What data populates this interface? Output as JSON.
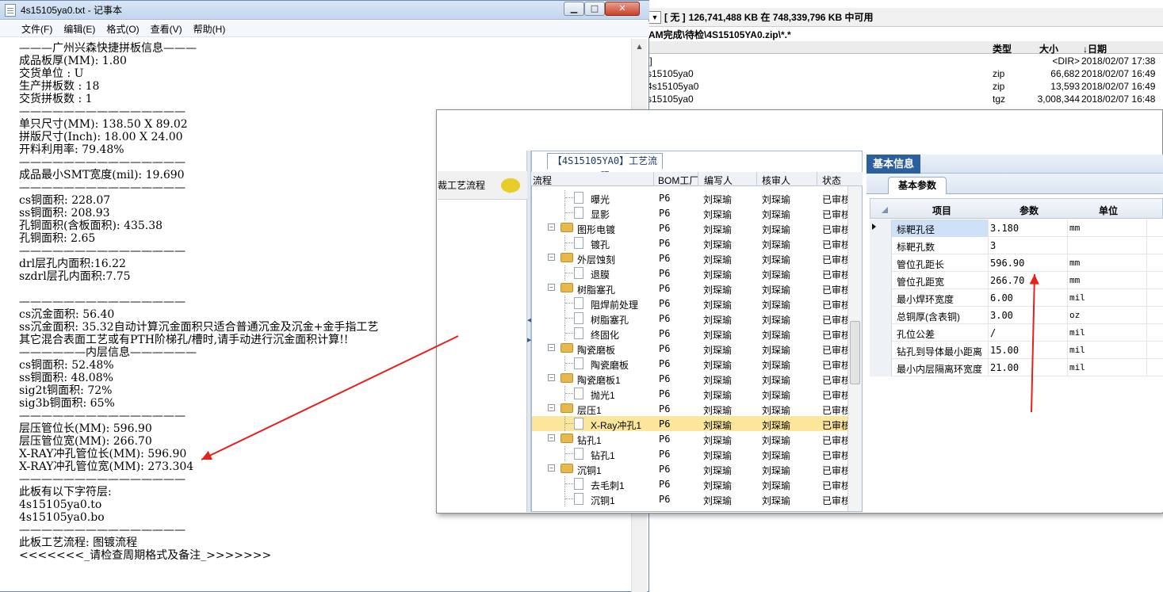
{
  "file_manager": {
    "left_fragment": "b 在",
    "drive_label": "[ 无 ]",
    "free_space": "126,741,488 KB 在 748,339,796 KB 中可用",
    "path": "AM完成\\待检\\4S15105YA0.zip\\*.*",
    "headers": {
      "type": "类型",
      "size": "大小",
      "date": "↓日期"
    },
    "rows": [
      {
        "name": ".]",
        "type": "",
        "size": "<DIR>",
        "date": "2018/02/07 17:38"
      },
      {
        "name": "s15105ya0",
        "type": "zip",
        "size": "66,682",
        "date": "2018/02/07 16:49"
      },
      {
        "name": "4s15105ya0",
        "type": "zip",
        "size": "13,593",
        "date": "2018/02/07 16:49"
      },
      {
        "name": "s15105ya0",
        "type": "tgz",
        "size": "3,008,344",
        "date": "2018/02/07 16:48"
      }
    ]
  },
  "notepad": {
    "title": "4s15105ya0.txt - 记事本",
    "window_buttons": {
      "minimize": "▁",
      "maximize": "□",
      "close": "✕"
    },
    "menu": [
      "文件(F)",
      "编辑(E)",
      "格式(O)",
      "查看(V)",
      "帮助(H)"
    ],
    "lines": [
      "———广州兴森快捷拼板信息———",
      "成品板厚(MM): 1.80",
      "交货单位 : U",
      "生产拼板数 : 18",
      "交货拼板数 : 1",
      "———————————————",
      "单只尺寸(MM): 138.50 X 89.02",
      "拼版尺寸(Inch): 18.00 X 24.00",
      "开料利用率: 79.48%",
      "———————————————",
      "成品最小SMT宽度(mil): 19.690",
      "———————————————",
      "cs铜面积: 228.07",
      "ss铜面积: 208.93",
      "孔铜面积(含板面积): 435.38",
      "孔铜面积: 2.65",
      "———————————————",
      "drl层孔内面积:16.22",
      "szdrl层孔内面积:7.75",
      "",
      "———————————————",
      "cs沉金面积: 56.40",
      "ss沉金面积: 35.32自动计算沉金面积只适合普通沉金及沉金+金手指工艺",
      "其它混合表面工艺或有PTH阶梯孔/槽时,请手动进行沉金面积计算!!",
      "——————内层信息——————",
      "cs铜面积: 52.48%",
      "ss铜面积: 48.08%",
      "sig2t铜面积: 72%",
      "sig3b铜面积: 65%",
      "———————————————",
      "层压管位长(MM): 596.90",
      "层压管位宽(MM): 266.70",
      "X-RAY冲孔管位长(MM): 596.90",
      "X-RAY冲孔管位宽(MM): 273.304",
      "———————————————",
      "此板有以下字符层:",
      "4s15105ya0.to",
      "4s15105ya0.bo",
      "———————————————",
      "此板工艺流程: 图镀流程",
      "<<<<<<<_请检查周期格式及备注_>>>>>>>"
    ]
  },
  "process_dialog": {
    "left_panel_label": "裁工艺流程",
    "flow_tab": "【4S15105YA0】工艺流程",
    "columns": [
      "流程",
      "BOM工厂",
      "编写人",
      "核审人",
      "状态"
    ],
    "rows": [
      {
        "name": "曝光",
        "level": 2,
        "kind": "doc",
        "bom": "P6",
        "writer": "刘琛瑜",
        "reviewer": "刘琛瑜",
        "status": "已审核"
      },
      {
        "name": "显影",
        "level": 2,
        "kind": "doc",
        "bom": "P6",
        "writer": "刘琛瑜",
        "reviewer": "刘琛瑜",
        "status": "已审核"
      },
      {
        "name": "图形电镀",
        "level": 1,
        "kind": "folder",
        "bom": "P6",
        "writer": "刘琛瑜",
        "reviewer": "刘琛瑜",
        "status": "已审核"
      },
      {
        "name": "镀孔",
        "level": 2,
        "kind": "doc",
        "bom": "P6",
        "writer": "刘琛瑜",
        "reviewer": "刘琛瑜",
        "status": "已审核"
      },
      {
        "name": "外层蚀刻",
        "level": 1,
        "kind": "folder",
        "bom": "P6",
        "writer": "刘琛瑜",
        "reviewer": "刘琛瑜",
        "status": "已审核"
      },
      {
        "name": "退膜",
        "level": 2,
        "kind": "doc",
        "bom": "P6",
        "writer": "刘琛瑜",
        "reviewer": "刘琛瑜",
        "status": "已审核"
      },
      {
        "name": "树脂塞孔",
        "level": 1,
        "kind": "folder",
        "bom": "P6",
        "writer": "刘琛瑜",
        "reviewer": "刘琛瑜",
        "status": "已审核"
      },
      {
        "name": "阻焊前处理",
        "level": 2,
        "kind": "doc",
        "bom": "P6",
        "writer": "刘琛瑜",
        "reviewer": "刘琛瑜",
        "status": "已审核"
      },
      {
        "name": "树脂塞孔",
        "level": 2,
        "kind": "doc",
        "bom": "P6",
        "writer": "刘琛瑜",
        "reviewer": "刘琛瑜",
        "status": "已审核"
      },
      {
        "name": "终固化",
        "level": 2,
        "kind": "doc",
        "bom": "P6",
        "writer": "刘琛瑜",
        "reviewer": "刘琛瑜",
        "status": "已审核"
      },
      {
        "name": "陶瓷磨板",
        "level": 1,
        "kind": "folder",
        "bom": "P6",
        "writer": "刘琛瑜",
        "reviewer": "刘琛瑜",
        "status": "已审核"
      },
      {
        "name": "陶瓷磨板",
        "level": 2,
        "kind": "doc",
        "bom": "P6",
        "writer": "刘琛瑜",
        "reviewer": "刘琛瑜",
        "status": "已审核"
      },
      {
        "name": "陶瓷磨板1",
        "level": 1,
        "kind": "folder",
        "bom": "P6",
        "writer": "刘琛瑜",
        "reviewer": "刘琛瑜",
        "status": "已审核"
      },
      {
        "name": "抛光1",
        "level": 2,
        "kind": "doc",
        "bom": "P6",
        "writer": "刘琛瑜",
        "reviewer": "刘琛瑜",
        "status": "已审核"
      },
      {
        "name": "层压1",
        "level": 1,
        "kind": "folder",
        "bom": "P6",
        "writer": "刘琛瑜",
        "reviewer": "刘琛瑜",
        "status": "已审核"
      },
      {
        "name": "X-Ray冲孔1",
        "level": 2,
        "kind": "doc",
        "bom": "P6",
        "writer": "刘琛瑜",
        "reviewer": "刘琛瑜",
        "status": "已审核",
        "selected": true
      },
      {
        "name": "钻孔1",
        "level": 1,
        "kind": "folder",
        "bom": "P6",
        "writer": "刘琛瑜",
        "reviewer": "刘琛瑜",
        "status": "已审核"
      },
      {
        "name": "钻孔1",
        "level": 2,
        "kind": "doc",
        "bom": "P6",
        "writer": "刘琛瑜",
        "reviewer": "刘琛瑜",
        "status": "已审核"
      },
      {
        "name": "沉铜1",
        "level": 1,
        "kind": "folder",
        "bom": "P6",
        "writer": "刘琛瑜",
        "reviewer": "刘琛瑜",
        "status": "已审核"
      },
      {
        "name": "去毛刺1",
        "level": 2,
        "kind": "doc",
        "bom": "P6",
        "writer": "刘琛瑜",
        "reviewer": "刘琛瑜",
        "status": "已审核"
      },
      {
        "name": "沉铜1",
        "level": 2,
        "kind": "doc",
        "bom": "P6",
        "writer": "刘琛瑜",
        "reviewer": "刘琛瑜",
        "status": "已审核"
      }
    ],
    "info_tab": "基本信息",
    "param_tab": "基本参数",
    "param_headers": [
      "项目",
      "参数",
      "单位"
    ],
    "params": [
      {
        "name": "标靶孔径",
        "value": "3.180",
        "unit": "mm"
      },
      {
        "name": "标靶孔数",
        "value": "3",
        "unit": ""
      },
      {
        "name": "管位孔距长",
        "value": "596.90",
        "unit": "mm"
      },
      {
        "name": "管位孔距宽",
        "value": "266.70",
        "unit": "mm"
      },
      {
        "name": "最小焊环宽度",
        "value": "6.00",
        "unit": "mil"
      },
      {
        "name": "总铜厚(含表铜)",
        "value": "3.00",
        "unit": "oz"
      },
      {
        "name": "孔位公差",
        "value": "/",
        "unit": "mil"
      },
      {
        "name": "钻孔到导体最小距离",
        "value": "15.00",
        "unit": "mil"
      },
      {
        "name": "最小内层隔离环宽度",
        "value": "21.00",
        "unit": "mil"
      }
    ]
  },
  "annotation_color": "#e8201c"
}
